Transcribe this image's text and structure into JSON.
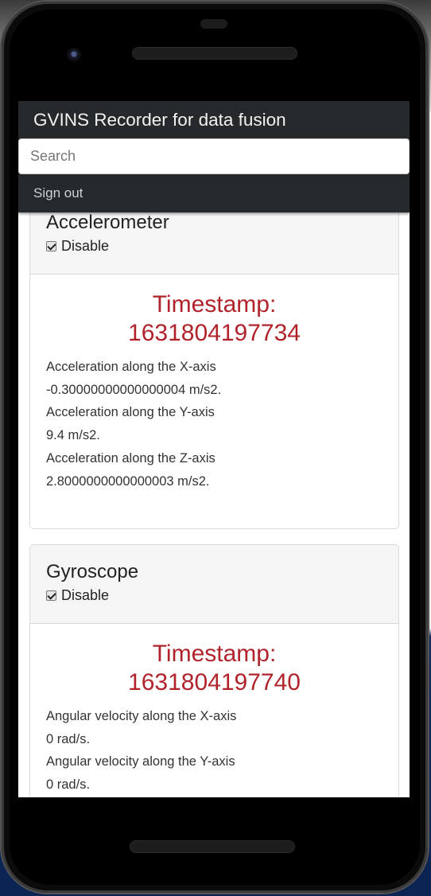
{
  "app": {
    "title": "GVINS Recorder for data fusion",
    "search_placeholder": "Search",
    "signout_label": "Sign out"
  },
  "accelerometer": {
    "title": "Accelerometer",
    "disable_label": "Disable",
    "disable_checked": true,
    "timestamp_label": "Timestamp:",
    "timestamp_value": "1631804197734",
    "readings": [
      "Acceleration along the X-axis",
      "-0.30000000000000004 m/s2.",
      "Acceleration along the Y-axis",
      "9.4 m/s2.",
      "Acceleration along the Z-axis",
      "2.8000000000000003 m/s2."
    ]
  },
  "gyroscope": {
    "title": "Gyroscope",
    "disable_label": "Disable",
    "disable_checked": true,
    "timestamp_label": "Timestamp:",
    "timestamp_value": "1631804197740",
    "readings": [
      "Angular velocity along the X-axis",
      "0 rad/s.",
      "Angular velocity along the Y-axis",
      "0 rad/s."
    ]
  },
  "colors": {
    "appbar": "#25292c",
    "timestamp": "#b1232b",
    "card_header": "#f5f5f5"
  }
}
